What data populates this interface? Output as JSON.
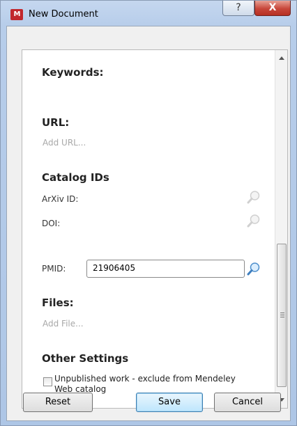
{
  "window": {
    "title": "New Document",
    "app_icon_text": "M",
    "help_button_label": "?",
    "close_button_label": "X"
  },
  "form": {
    "keywords_heading": "Keywords:",
    "url_heading": "URL:",
    "url_placeholder": "Add URL...",
    "catalog_heading": "Catalog IDs",
    "arxiv_label": "ArXiv ID:",
    "doi_label": "DOI:",
    "pmid_label": "PMID:",
    "pmid_value": "21906405",
    "files_heading": "Files:",
    "files_placeholder": "Add File...",
    "other_heading": "Other Settings",
    "unpublished_label": "Unpublished work - exclude from Mendeley Web catalog",
    "unpublished_checked": false
  },
  "footer": {
    "reset_label": "Reset",
    "save_label": "Save",
    "cancel_label": "Cancel"
  },
  "icons": {
    "lookup": "magnifier-icon",
    "app": "mendeley-logo-icon"
  },
  "colors": {
    "title_bar": "#b7cdea",
    "close_button": "#c7463a",
    "primary_button": "#bee6fd"
  }
}
